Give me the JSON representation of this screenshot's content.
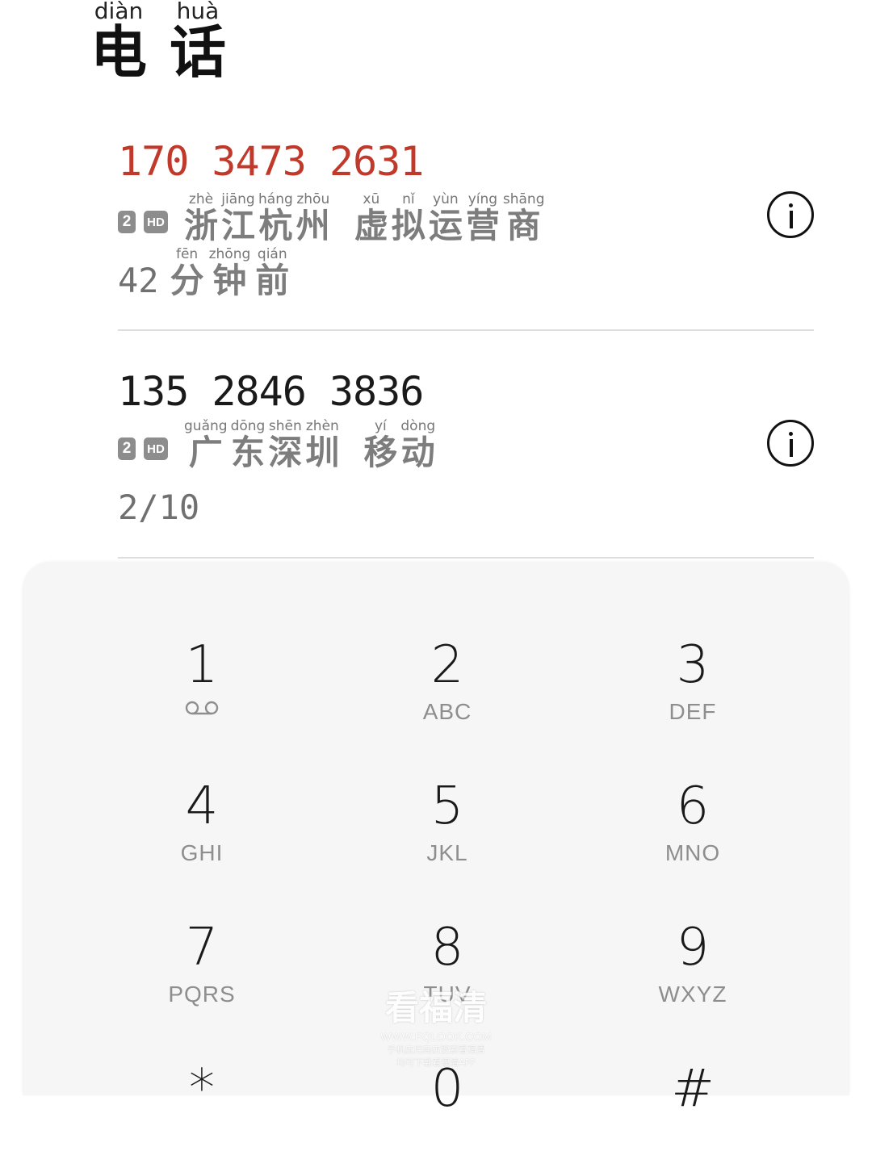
{
  "header": {
    "title": [
      {
        "pinyin": "diàn",
        "hanzi": "电"
      },
      {
        "pinyin": "huà",
        "hanzi": "话"
      }
    ]
  },
  "calls": [
    {
      "number": "170 3473 2631",
      "missed": true,
      "sim": "2",
      "hd": "HD",
      "location": [
        {
          "pinyin": "zhè",
          "hanzi": "浙"
        },
        {
          "pinyin": "jiāng",
          "hanzi": "江"
        },
        {
          "pinyin": "háng",
          "hanzi": "杭"
        },
        {
          "pinyin": "zhōu",
          "hanzi": "州"
        },
        {
          "space": true
        },
        {
          "pinyin": "xū",
          "hanzi": "虚"
        },
        {
          "pinyin": "nǐ",
          "hanzi": "拟"
        },
        {
          "pinyin": "yùn",
          "hanzi": "运"
        },
        {
          "pinyin": "yíng",
          "hanzi": "营"
        },
        {
          "pinyin": "shāng",
          "hanzi": "商"
        }
      ],
      "time_digits": "42",
      "time_words": [
        {
          "pinyin": "fēn",
          "hanzi": "分"
        },
        {
          "pinyin": "zhōng",
          "hanzi": "钟"
        },
        {
          "pinyin": "qián",
          "hanzi": "前"
        }
      ]
    },
    {
      "number": "135 2846 3836",
      "missed": false,
      "sim": "2",
      "hd": "HD",
      "location": [
        {
          "pinyin": "guǎng",
          "hanzi": "广"
        },
        {
          "pinyin": "dōng",
          "hanzi": "东"
        },
        {
          "pinyin": "shēn",
          "hanzi": "深"
        },
        {
          "pinyin": "zhèn",
          "hanzi": "圳"
        },
        {
          "space": true
        },
        {
          "pinyin": "yí",
          "hanzi": "移"
        },
        {
          "pinyin": "dòng",
          "hanzi": "动"
        }
      ],
      "time_digits": "2/10",
      "time_words": []
    }
  ],
  "dialpad": [
    {
      "digit": "1",
      "letters": "",
      "voicemail": true
    },
    {
      "digit": "2",
      "letters": "ABC"
    },
    {
      "digit": "3",
      "letters": "DEF"
    },
    {
      "digit": "4",
      "letters": "GHI"
    },
    {
      "digit": "5",
      "letters": "JKL"
    },
    {
      "digit": "6",
      "letters": "MNO"
    },
    {
      "digit": "7",
      "letters": "PQRS"
    },
    {
      "digit": "8",
      "letters": "TUV"
    },
    {
      "digit": "9",
      "letters": "WXYZ"
    },
    {
      "digit": "*",
      "letters": ""
    },
    {
      "digit": "0",
      "letters": ""
    },
    {
      "digit": "#",
      "letters": ""
    }
  ],
  "watermark": {
    "line1": "看福清",
    "line2": "WWW.FQLOOK.COM",
    "line3": "手机应用商店搜索看福清",
    "line4": "均可下载看福清APP"
  },
  "colors": {
    "missed": "#c0392b",
    "badge": "#8d8d8d",
    "pad": "#f6f6f6"
  }
}
